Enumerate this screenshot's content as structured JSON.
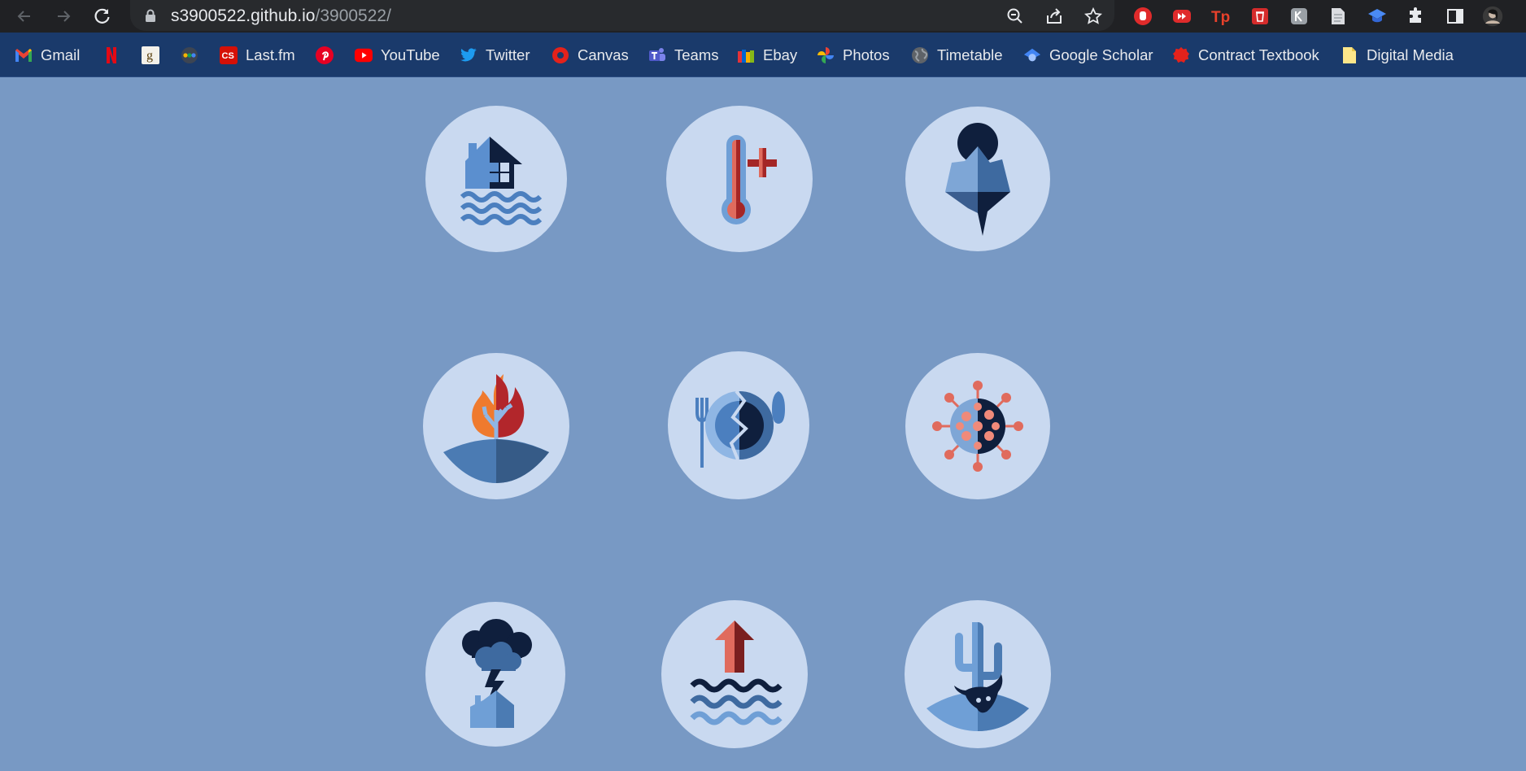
{
  "browser": {
    "url_host": "s3900522.github.io",
    "url_path": "/3900522/"
  },
  "bookmarks": [
    {
      "label": "Gmail",
      "icon": "gmail-icon"
    },
    {
      "label": "",
      "icon": "netflix-icon"
    },
    {
      "label": "",
      "icon": "goodreads-icon"
    },
    {
      "label": "",
      "icon": "dots-icon"
    },
    {
      "label": "Last.fm",
      "icon": "lastfm-icon"
    },
    {
      "label": "",
      "icon": "pinterest-icon"
    },
    {
      "label": "YouTube",
      "icon": "youtube-icon"
    },
    {
      "label": "Twitter",
      "icon": "twitter-icon"
    },
    {
      "label": "Canvas",
      "icon": "canvas-icon"
    },
    {
      "label": "Teams",
      "icon": "teams-icon"
    },
    {
      "label": "Ebay",
      "icon": "ebay-icon"
    },
    {
      "label": "Photos",
      "icon": "photos-icon"
    },
    {
      "label": "Timetable",
      "icon": "globe-icon"
    },
    {
      "label": "Google Scholar",
      "icon": "scholar-icon"
    },
    {
      "label": "Contract Textbook",
      "icon": "textbook-icon"
    },
    {
      "label": "Digital Media",
      "icon": "folder-icon"
    }
  ],
  "icons": [
    {
      "name": "flooded-house-icon"
    },
    {
      "name": "thermometer-heat-icon"
    },
    {
      "name": "melting-iceberg-icon"
    },
    {
      "name": "wildfire-tree-icon"
    },
    {
      "name": "broken-plate-food-icon"
    },
    {
      "name": "virus-icon"
    },
    {
      "name": "storm-house-icon"
    },
    {
      "name": "sea-level-rise-icon"
    },
    {
      "name": "drought-cactus-icon"
    }
  ],
  "colors": {
    "page_bg": "#7899c4",
    "circle_bg": "#c9d9f0",
    "navy": "#0f1f3d",
    "mid_blue": "#3e6aa0",
    "light_blue": "#6f9fd6",
    "red": "#b2262b",
    "orange": "#ef7a2e",
    "salmon": "#e06b5d"
  }
}
